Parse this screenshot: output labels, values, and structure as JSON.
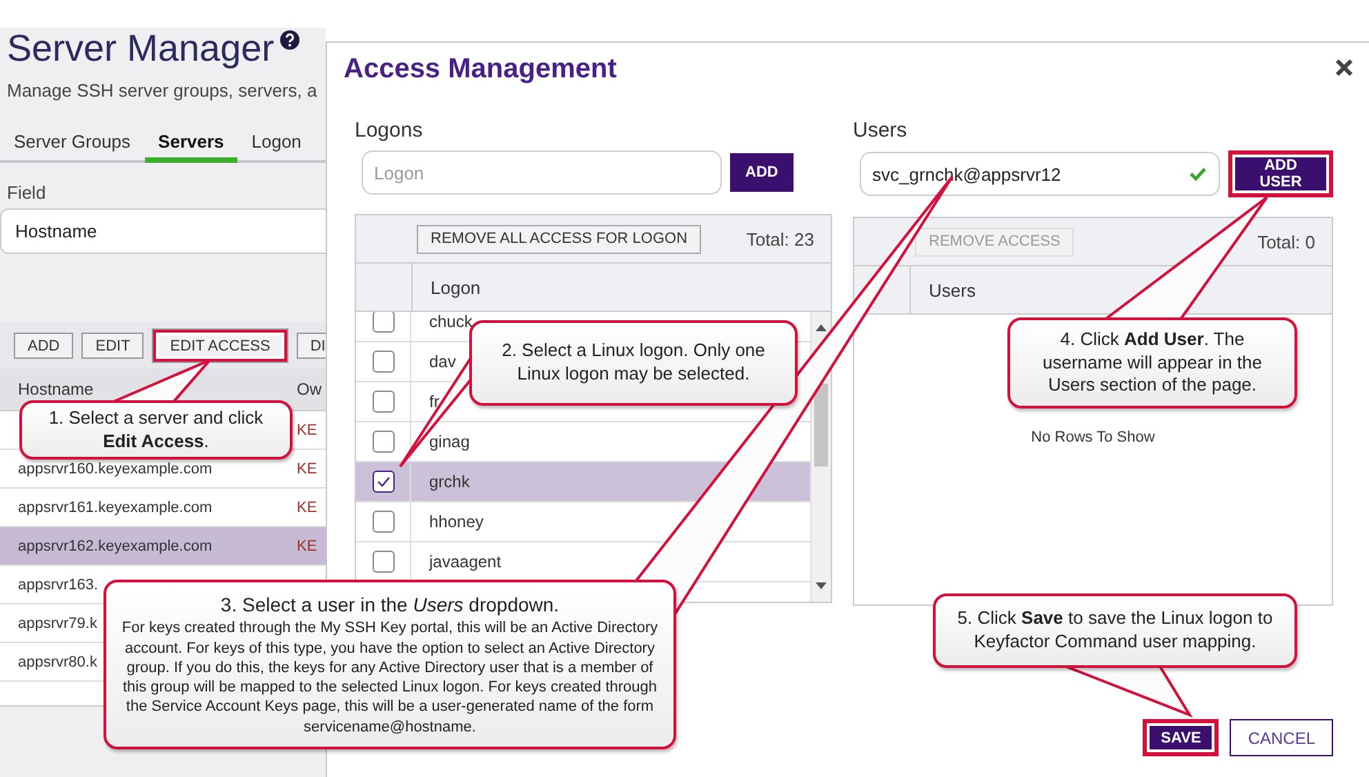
{
  "page": {
    "title": "Server Manager",
    "subtitle": "Manage SSH server groups, servers, a",
    "tabs": [
      {
        "label": "Server Groups",
        "selected": false
      },
      {
        "label": "Servers",
        "selected": true
      },
      {
        "label": "Logon",
        "selected": false
      }
    ],
    "field": {
      "label": "Field",
      "value": "Hostname"
    },
    "grid": {
      "buttons": [
        {
          "label": "ADD",
          "highlighted": false
        },
        {
          "label": "EDIT",
          "highlighted": false
        },
        {
          "label": "EDIT ACCESS",
          "highlighted": true
        },
        {
          "label": "DI",
          "highlighted": false
        }
      ],
      "columns": [
        "Hostname",
        "Ow"
      ],
      "rows": [
        {
          "owner": "KE",
          "selected": false
        },
        {
          "hostname": "appsrvr160.keyexample.com",
          "owner": "KE",
          "selected": false
        },
        {
          "hostname": "appsrvr161.keyexample.com",
          "owner": "KE",
          "selected": false
        },
        {
          "hostname": "appsrvr162.keyexample.com",
          "owner": "KE",
          "selected": true
        },
        {
          "hostname": "appsrvr163.",
          "selected": false
        },
        {
          "hostname": "appsrvr79.k",
          "selected": false
        },
        {
          "hostname": "appsrvr80.k",
          "selected": false
        }
      ]
    }
  },
  "dialog": {
    "title": "Access Management",
    "logons": {
      "label": "Logons",
      "input": {
        "placeholder": "Logon"
      },
      "add_button": {
        "label": "ADD",
        "highlighted": false
      },
      "toolbar_button": {
        "label": "REMOVE ALL ACCESS FOR LOGON",
        "disabled": false
      },
      "total": "Total: 23",
      "column": "Logon",
      "rows": [
        {
          "name": "chuck",
          "checked": false,
          "selected": false
        },
        {
          "name": "dav",
          "checked": false,
          "selected": false
        },
        {
          "name": "fr",
          "checked": false,
          "selected": false
        },
        {
          "name": "ginag",
          "checked": false,
          "selected": false
        },
        {
          "name": "grchk",
          "checked": true,
          "selected": true
        },
        {
          "name": "hhoney",
          "checked": false,
          "selected": false
        },
        {
          "name": "javaagent",
          "checked": false,
          "selected": false
        }
      ]
    },
    "users": {
      "label": "Users",
      "input": {
        "value": "svc_grnchk@appsrvr12",
        "valid": true
      },
      "add_button": {
        "label": "ADD USER",
        "highlighted": true
      },
      "toolbar_button": {
        "label": "REMOVE ACCESS",
        "disabled": true
      },
      "total": "Total: 0",
      "column": "Users",
      "empty_text": "No Rows To Show"
    },
    "buttons": [
      {
        "label": "SAVE",
        "kind": "primary",
        "highlighted": true
      },
      {
        "label": "CANCEL",
        "kind": "secondary",
        "highlighted": false
      }
    ]
  },
  "callouts": [
    {
      "text": "1. Select a server and click **Edit Access**."
    },
    {
      "text": "2. Select a Linux logon. Only one Linux logon may be selected."
    },
    {
      "heading": "3. Select a  user in the *Users* dropdown.",
      "text": "For keys created through the My SSH Key portal, this will be an Active Directory account. For keys of this type, you have the option to select an Active Directory group. If you do this, the keys for any Active Directory user that is a member of this group will be mapped to the selected Linux logon. For keys created through the Service Account Keys page, this will be a user-generated name of the form servicename@hostname."
    },
    {
      "text": "4. Click **Add User**. The username will appear in the Users section of the page."
    },
    {
      "text": "5. Click **Save** to save the Linux logon to Keyfactor Command user mapping."
    }
  ]
}
